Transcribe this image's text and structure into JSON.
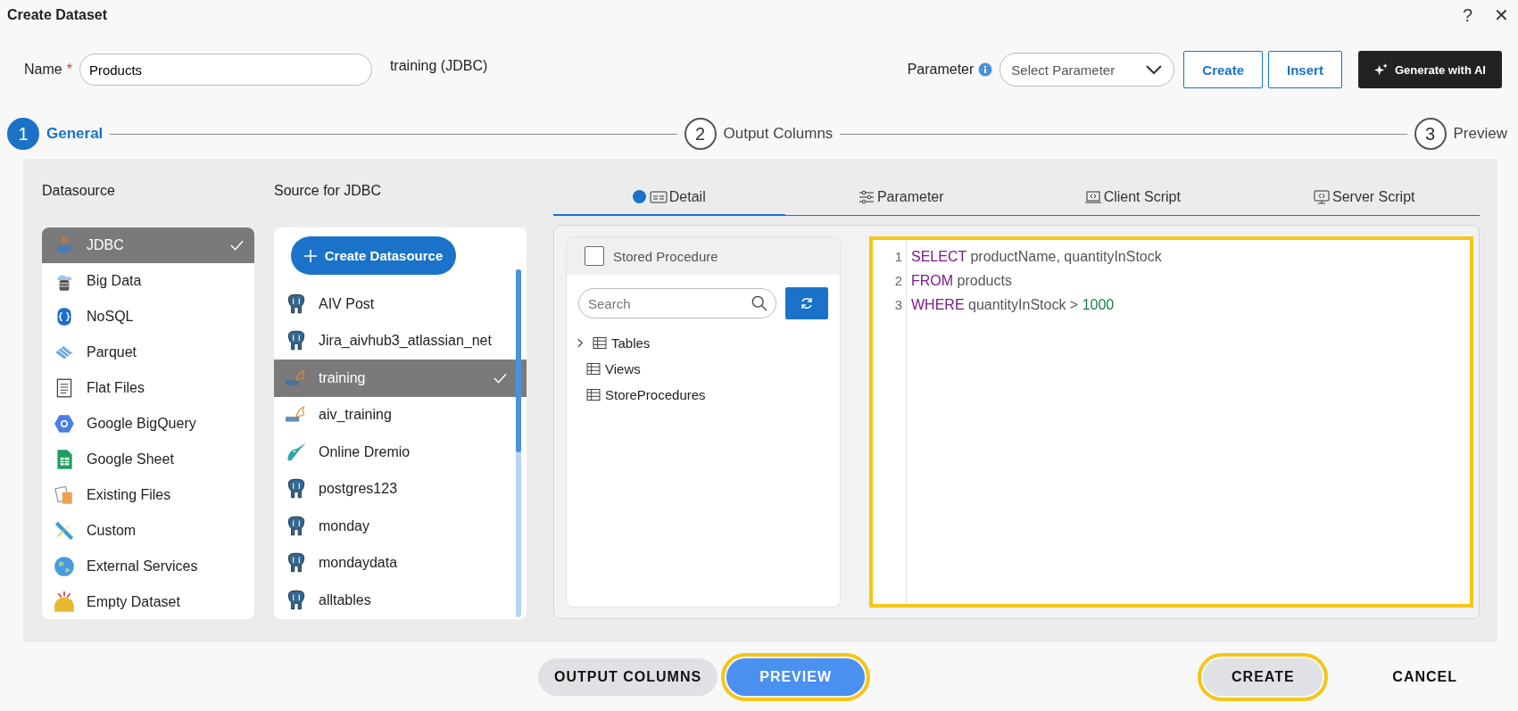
{
  "window": {
    "title": "Create Dataset",
    "help": "?",
    "close": "✕"
  },
  "name_field": {
    "label": "Name",
    "required": "*",
    "value": "Products"
  },
  "source_label": "training (JDBC)",
  "parameter": {
    "label": "Parameter",
    "placeholder": "Select Parameter"
  },
  "top_buttons": [
    {
      "label": "Create",
      "kind": "outline"
    },
    {
      "label": "Insert",
      "kind": "outline"
    },
    {
      "label": "Generate with AI",
      "kind": "ai"
    }
  ],
  "steps": [
    {
      "number": "1",
      "label": "General",
      "selected": true
    },
    {
      "number": "2",
      "label": "Output Columns",
      "selected": false
    },
    {
      "number": "3",
      "label": "Preview",
      "selected": false
    }
  ],
  "datasource": {
    "title": "Datasource",
    "items": [
      {
        "label": "JDBC",
        "kind": "jdbc",
        "selected": true
      },
      {
        "label": "Big Data",
        "kind": "bigdata",
        "selected": false
      },
      {
        "label": "NoSQL",
        "kind": "nosql",
        "selected": false
      },
      {
        "label": "Parquet",
        "kind": "parquet",
        "selected": false
      },
      {
        "label": "Flat Files",
        "kind": "file",
        "selected": false
      },
      {
        "label": "Google BigQuery",
        "kind": "bigquery",
        "selected": false
      },
      {
        "label": "Google Sheet",
        "kind": "sheet",
        "selected": false
      },
      {
        "label": "Existing Files",
        "kind": "existing",
        "selected": false
      },
      {
        "label": "Custom",
        "kind": "custom",
        "selected": false
      },
      {
        "label": "External Services",
        "kind": "globe",
        "selected": false
      },
      {
        "label": "Empty Dataset",
        "kind": "empty",
        "selected": false
      }
    ]
  },
  "sources": {
    "title": "Source for JDBC",
    "create_button": "Create Datasource",
    "items": [
      {
        "label": "AIV Post",
        "kind": "postgres",
        "selected": false
      },
      {
        "label": "Jira_aivhub3_atlassian_net",
        "kind": "postgres",
        "selected": false
      },
      {
        "label": "training",
        "kind": "mysql",
        "selected": true
      },
      {
        "label": "aiv_training",
        "kind": "mysql",
        "selected": false
      },
      {
        "label": "Online Dremio",
        "kind": "dremio",
        "selected": false
      },
      {
        "label": "postgres123",
        "kind": "postgres",
        "selected": false
      },
      {
        "label": "monday",
        "kind": "postgres",
        "selected": false
      },
      {
        "label": "mondaydata",
        "kind": "postgres",
        "selected": false
      },
      {
        "label": "alltables",
        "kind": "postgres",
        "selected": false
      }
    ]
  },
  "tabs": [
    {
      "label": "Detail",
      "kind": "detail",
      "selected": true
    },
    {
      "label": "Parameter",
      "kind": "parameter",
      "selected": false
    },
    {
      "label": "Client Script",
      "kind": "client",
      "selected": false
    },
    {
      "label": "Server Script",
      "kind": "server",
      "selected": false
    }
  ],
  "schema_panel": {
    "stored_procedure": {
      "label": "Stored Procedure",
      "checked": false
    },
    "search_placeholder": "Search",
    "tree": [
      {
        "label": "Tables",
        "kind": "group",
        "expanded": false
      },
      {
        "label": "Views",
        "kind": "leaf"
      },
      {
        "label": "StoreProcedures",
        "kind": "leaf"
      }
    ]
  },
  "editor": {
    "highlighted": true,
    "lines": [
      {
        "number": "1",
        "tokens": [
          {
            "kind": "keyword",
            "text": "SELECT"
          },
          {
            "kind": "plain",
            "text": " productName, quantityInStock"
          }
        ]
      },
      {
        "number": "2",
        "tokens": [
          {
            "kind": "keyword",
            "text": "FROM"
          },
          {
            "kind": "plain",
            "text": " products"
          }
        ]
      },
      {
        "number": "3",
        "tokens": [
          {
            "kind": "keyword",
            "text": "WHERE"
          },
          {
            "kind": "plain",
            "text": " quantityInStock > "
          },
          {
            "kind": "number",
            "text": "1000"
          }
        ]
      }
    ]
  },
  "bottom_left_buttons": [
    {
      "label": "OUTPUT COLUMNS",
      "kind": "secondary",
      "highlighted": false
    },
    {
      "label": "PREVIEW",
      "kind": "primary",
      "highlighted": true
    }
  ],
  "bottom_right_buttons": [
    {
      "label": "CREATE",
      "kind": "secondary",
      "highlighted": true
    },
    {
      "label": "CANCEL",
      "kind": "text",
      "highlighted": false
    }
  ]
}
